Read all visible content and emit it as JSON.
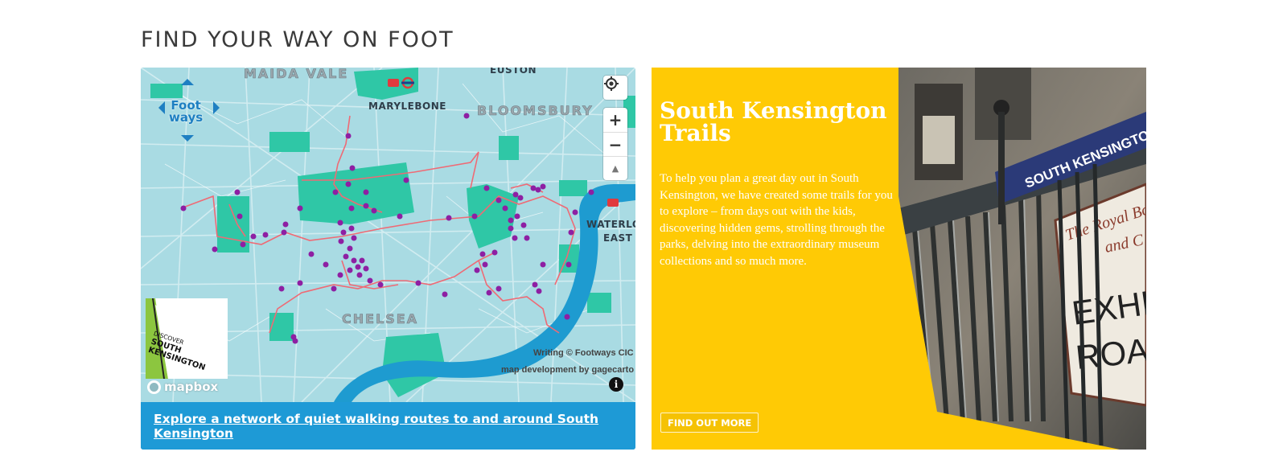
{
  "section": {
    "title": "FIND YOUR WAY ON FOOT"
  },
  "map": {
    "caption_link": "Explore a network of quiet walking routes to and around South Kensington",
    "labels": {
      "maida_vale": "MAIDA VALE",
      "euston": "EUSTON",
      "marylebone": "MARYLEBONE",
      "bloomsbury": "BLOOMSBURY",
      "waterloo": "WATERLO",
      "east": "EAST",
      "chelsea": "CHELSEA"
    },
    "footways_logo_line1": "Foot",
    "footways_logo_line2": "ways",
    "attribution_writing": "Writing © Footways CIC",
    "attribution_dev": "map development by gagecarto",
    "mapbox_label": "mapbox",
    "controls": {
      "locate_icon": "locate-icon",
      "zoom_in": "+",
      "zoom_out": "−",
      "compass": "▲"
    },
    "discover_logo": {
      "line1": "DISCOVER",
      "line2": "SOUTH",
      "line3": "KENSINGTON"
    },
    "info_icon": "i",
    "colors": {
      "water": "#1e9bd0",
      "park": "#2fc7a6",
      "route": "#ef6a75",
      "pin": "#8e1fa3",
      "land": "#a9dbe3"
    }
  },
  "trails": {
    "title": "South Kensington Trails",
    "body": "To help you plan a great day out in South Kensington, we have created some trails for you to explore – from days out with the kids, discovering hidden gems, strolling through the parks, delving into the extraordinary museum collections and so much more.",
    "button_label": "FIND OUT MORE",
    "photo_sign_lines": [
      "SOUTH KENSINGTON",
      "The Royal Borough",
      "and C",
      "EXHIB",
      "ROAD"
    ],
    "colors": {
      "card_bg": "#ffca05"
    }
  }
}
